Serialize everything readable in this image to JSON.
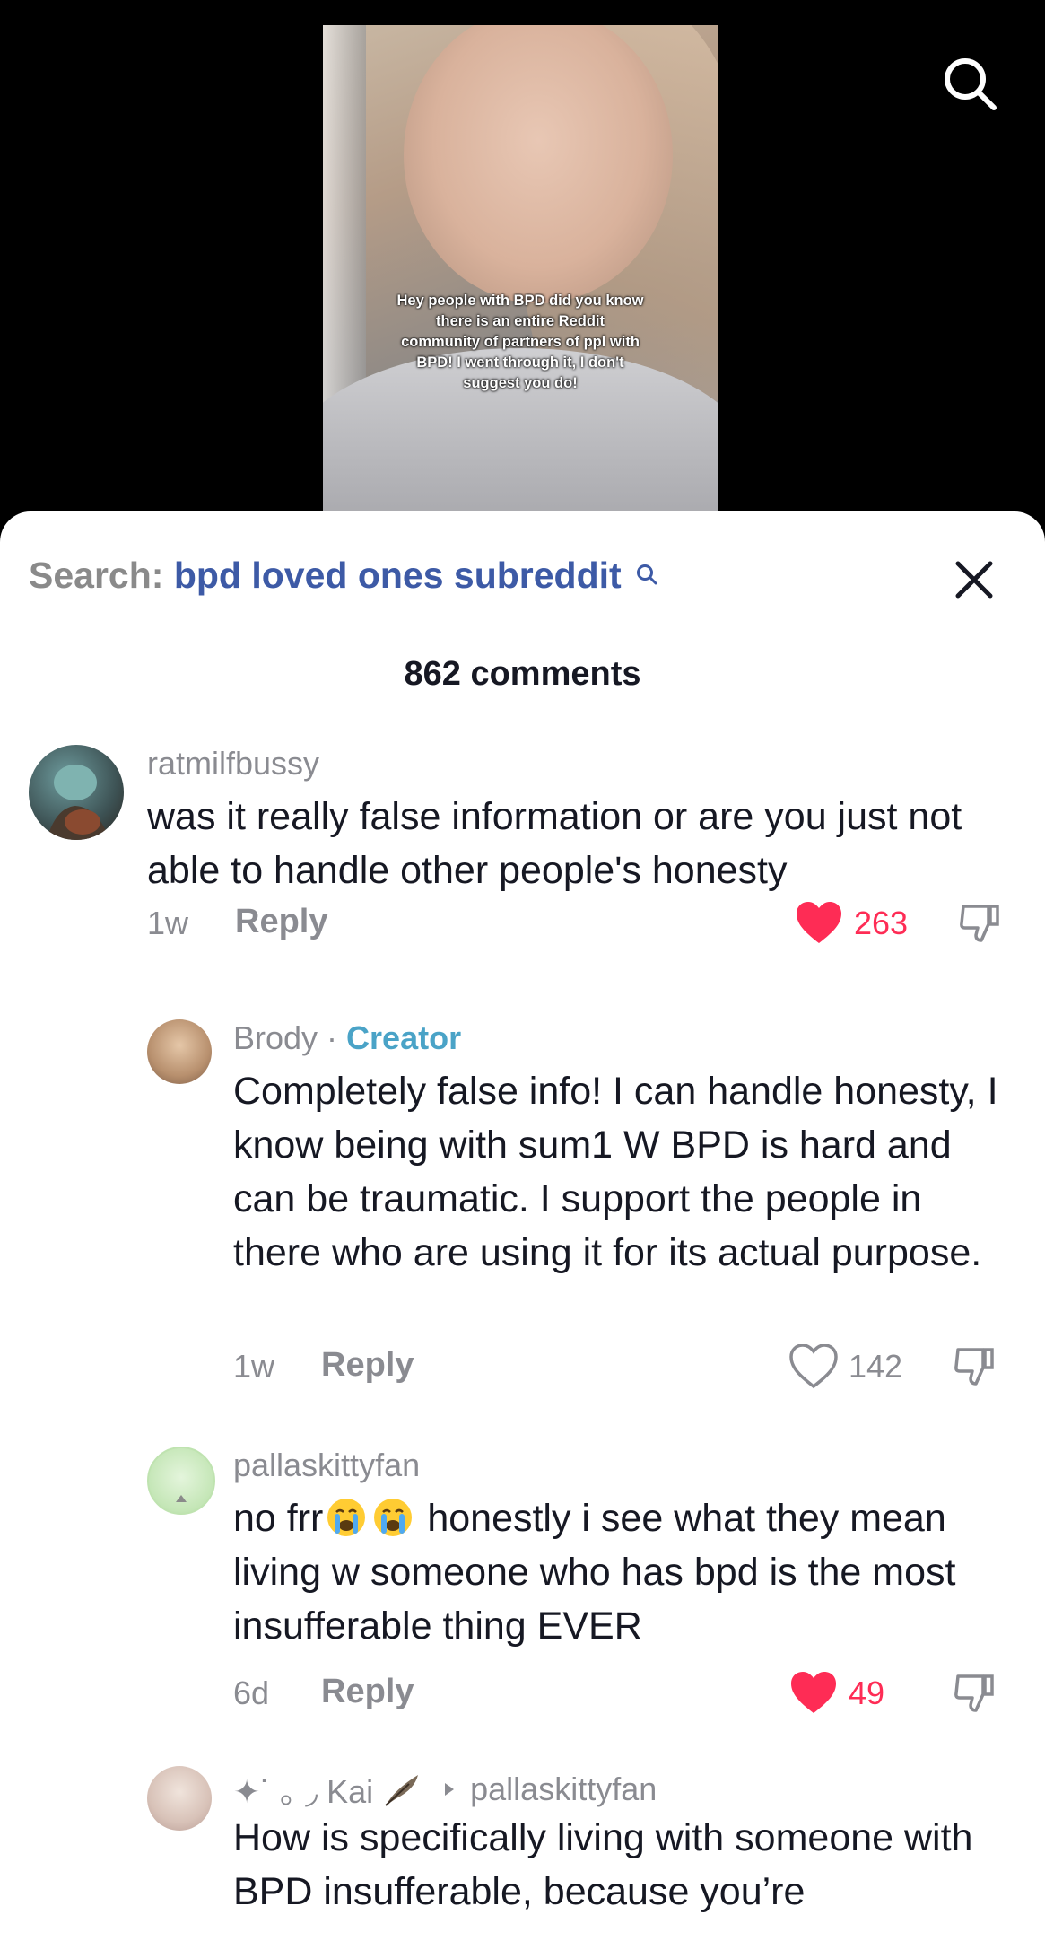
{
  "video": {
    "caption": "Hey people with BPD did you know there is an entire Reddit community of partners of ppl with BPD! I went through it, I don't suggest you do!"
  },
  "sheet": {
    "search_label": "Search:",
    "search_query": "bpd loved ones subreddit",
    "comment_count": "862 comments"
  },
  "comments": [
    {
      "username": "ratmilfbussy",
      "text": "was it really false information or are you just not able to handle other people's honesty",
      "time": "1w",
      "reply_label": "Reply",
      "likes": "263",
      "liked": true
    },
    {
      "username": "Brody",
      "separator": " · ",
      "badge": "Creator",
      "text": "Completely false info! I can handle honesty, I know being with sum1 W BPD is hard and can be traumatic. I support the people in there who are using it for its actual purpose.",
      "time": "1w",
      "reply_label": "Reply",
      "likes": "142",
      "liked": false
    },
    {
      "username": "pallaskittyfan",
      "text_before_emoji": "no frr",
      "text_after_emoji": " honestly i see what they mean living w someone who has bpd is the most insufferable thing EVER",
      "emojis": [
        "loudly-crying-face",
        "loudly-crying-face"
      ],
      "time": "6d",
      "reply_label": "Reply",
      "likes": "49",
      "liked": true
    },
    {
      "username": "✦˙ ｡ ◞ Kai",
      "reply_to": "pallaskittyfan",
      "text": "How is specifically living with someone with BPD insufferable, because you’re"
    }
  ],
  "colors": {
    "like_red": "#fe2c55",
    "query_blue": "#3d5aa6",
    "creator_blue": "#4aa3c7",
    "muted_gray": "#8a8b91"
  }
}
